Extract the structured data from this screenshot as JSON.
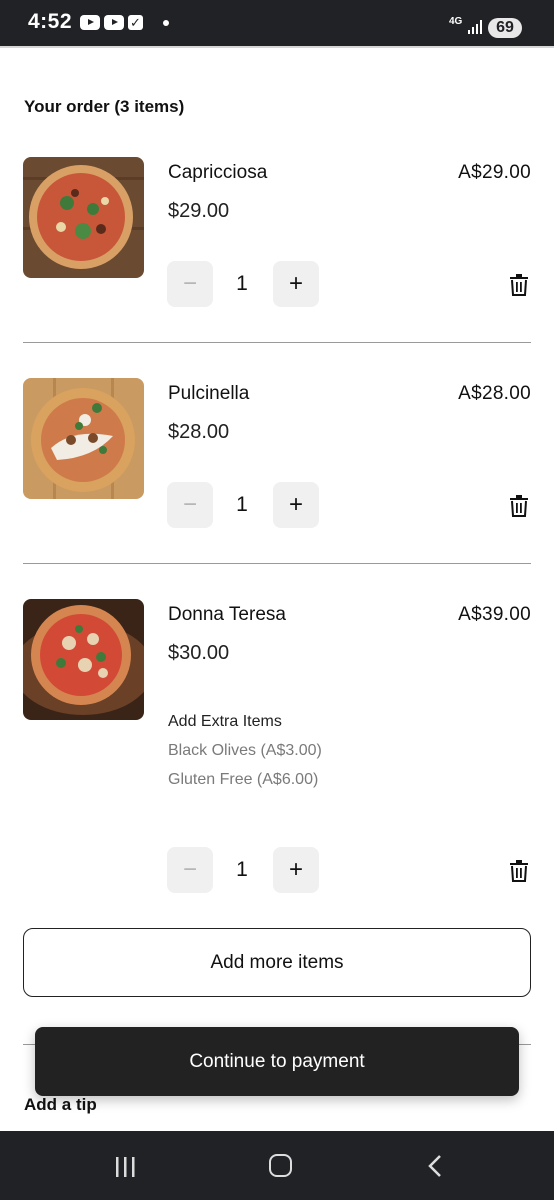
{
  "status_bar": {
    "time": "4:52",
    "network": "4G",
    "battery": "69"
  },
  "order": {
    "title": "Your order (3 items)",
    "items": [
      {
        "name": "Capricciosa",
        "total": "A$29.00",
        "price": "$29.00",
        "quantity": "1",
        "minus_label": "−",
        "plus_label": "+"
      },
      {
        "name": "Pulcinella",
        "total": "A$28.00",
        "price": "$28.00",
        "quantity": "1",
        "minus_label": "−",
        "plus_label": "+"
      },
      {
        "name": "Donna Teresa",
        "total": "A$39.00",
        "price": "$30.00",
        "quantity": "1",
        "minus_label": "−",
        "plus_label": "+",
        "extras_heading": "Add Extra Items",
        "extras": [
          "Black Olives (A$3.00)",
          "Gluten Free (A$6.00)"
        ]
      }
    ],
    "add_more_label": "Add more items",
    "tip_title": "Add a tip",
    "continue_label": "Continue to payment"
  },
  "icons": {
    "delete": "trash-icon",
    "nav_recent": "recent-apps-icon",
    "nav_home": "home-icon",
    "nav_back": "back-icon"
  }
}
